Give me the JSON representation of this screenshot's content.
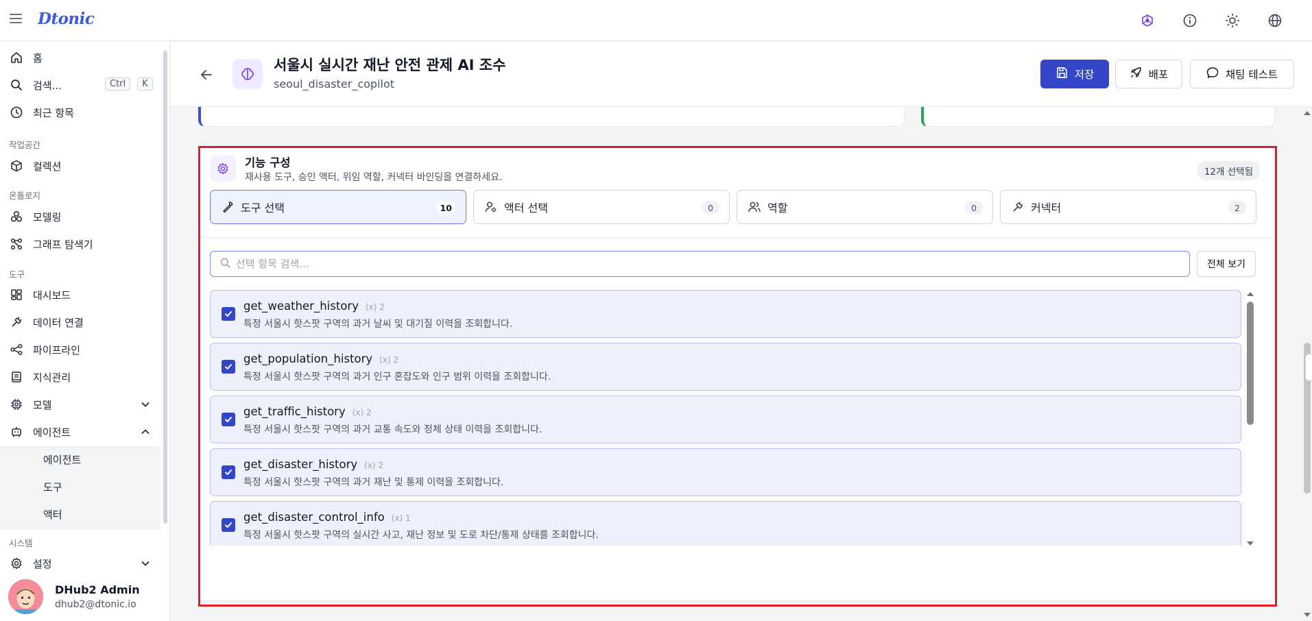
{
  "app": {
    "logo": "Dtonic"
  },
  "sidebar": {
    "home": "홈",
    "search": "검색...",
    "shortcut": [
      "Ctrl",
      "K"
    ],
    "recent": "최근 항목",
    "workspace_label": "작업공간",
    "collection": "컬렉션",
    "ontology_label": "온톨로지",
    "modeling": "모델링",
    "graph_explorer": "그래프 탐색기",
    "tools_label": "도구",
    "dashboard": "대시보드",
    "data_connection": "데이터 연결",
    "pipeline": "파이프라인",
    "knowledge": "지식관리",
    "model": "모델",
    "agent": "에이전트",
    "sub_agent": "에이전트",
    "sub_tool": "도구",
    "sub_actor": "액터",
    "system_label": "시스템",
    "settings": "설정"
  },
  "user": {
    "name": "DHub2 Admin",
    "email": "dhub2@dtonic.io"
  },
  "header": {
    "title": "서울시 실시간 재난 안전 관제 AI 조수",
    "subtitle": "seoul_disaster_copilot",
    "save": "저장",
    "deploy": "배포",
    "chat_test": "채팅 테스트"
  },
  "feature": {
    "title": "기능 구성",
    "description": "재사용 도구, 승인 액터, 위임 역할, 커넥터 바인딩을 연결하세요.",
    "selected": "12개 선택됨",
    "tabs": [
      {
        "label": "도구 선택",
        "count": "10"
      },
      {
        "label": "액터 선택",
        "count": "0"
      },
      {
        "label": "역할",
        "count": "0"
      },
      {
        "label": "커넥터",
        "count": "2"
      }
    ],
    "search_placeholder": "선택 항목 검색...",
    "view_all": "전체 보기",
    "items": [
      {
        "name": "get_weather_history",
        "meta": "(x) 2",
        "desc": "특정 서울시 핫스팟 구역의 과거 날씨 및 대기질 이력을 조회합니다."
      },
      {
        "name": "get_population_history",
        "meta": "(x) 2",
        "desc": "특정 서울시 핫스팟 구역의 과거 인구 혼잡도와 인구 범위 이력을 조회합니다."
      },
      {
        "name": "get_traffic_history",
        "meta": "(x) 2",
        "desc": "특정 서울시 핫스팟 구역의 과거 교통 속도와 정체 상태 이력을 조회합니다."
      },
      {
        "name": "get_disaster_history",
        "meta": "(x) 2",
        "desc": "특정 서울시 핫스팟 구역의 과거 재난 및 통제 이력을 조회합니다."
      },
      {
        "name": "get_disaster_control_info",
        "meta": "(x) 1",
        "desc": "특정 서울시 핫스팟 구역의 실시간 사고, 재난 정보 및 도로 차단/통제 상태를 조회합니다."
      }
    ]
  },
  "colors": {
    "accent": "#3346c8",
    "highlight": "#e11d2a",
    "brand": "#3b5bdb"
  },
  "icons": [
    "menu-icon",
    "ontology-icon",
    "info-icon",
    "sun-icon",
    "globe-icon",
    "home-icon",
    "search-icon",
    "clock-icon",
    "box-icon",
    "modeling-icon",
    "graph-icon",
    "dashboard-icon",
    "plug-icon",
    "pipeline-icon",
    "book-icon",
    "chip-icon",
    "robot-icon",
    "gear-icon",
    "back-arrow-icon",
    "brain-icon",
    "save-icon",
    "rocket-icon",
    "chat-icon",
    "wrench-icon",
    "user-cog-icon",
    "users-icon",
    "connector-icon",
    "check-icon"
  ]
}
